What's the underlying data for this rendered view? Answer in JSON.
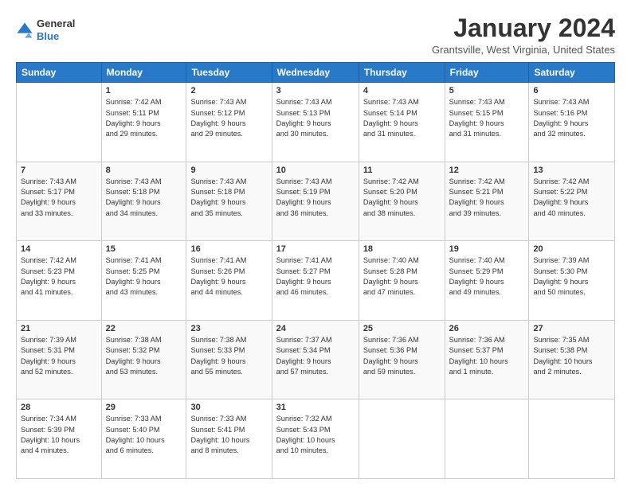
{
  "logo": {
    "general": "General",
    "blue": "Blue"
  },
  "title": "January 2024",
  "location": "Grantsville, West Virginia, United States",
  "days_of_week": [
    "Sunday",
    "Monday",
    "Tuesday",
    "Wednesday",
    "Thursday",
    "Friday",
    "Saturday"
  ],
  "weeks": [
    [
      {
        "day": "",
        "content": ""
      },
      {
        "day": "1",
        "content": "Sunrise: 7:42 AM\nSunset: 5:11 PM\nDaylight: 9 hours\nand 29 minutes."
      },
      {
        "day": "2",
        "content": "Sunrise: 7:43 AM\nSunset: 5:12 PM\nDaylight: 9 hours\nand 29 minutes."
      },
      {
        "day": "3",
        "content": "Sunrise: 7:43 AM\nSunset: 5:13 PM\nDaylight: 9 hours\nand 30 minutes."
      },
      {
        "day": "4",
        "content": "Sunrise: 7:43 AM\nSunset: 5:14 PM\nDaylight: 9 hours\nand 31 minutes."
      },
      {
        "day": "5",
        "content": "Sunrise: 7:43 AM\nSunset: 5:15 PM\nDaylight: 9 hours\nand 31 minutes."
      },
      {
        "day": "6",
        "content": "Sunrise: 7:43 AM\nSunset: 5:16 PM\nDaylight: 9 hours\nand 32 minutes."
      }
    ],
    [
      {
        "day": "7",
        "content": "Sunrise: 7:43 AM\nSunset: 5:17 PM\nDaylight: 9 hours\nand 33 minutes."
      },
      {
        "day": "8",
        "content": "Sunrise: 7:43 AM\nSunset: 5:18 PM\nDaylight: 9 hours\nand 34 minutes."
      },
      {
        "day": "9",
        "content": "Sunrise: 7:43 AM\nSunset: 5:18 PM\nDaylight: 9 hours\nand 35 minutes."
      },
      {
        "day": "10",
        "content": "Sunrise: 7:43 AM\nSunset: 5:19 PM\nDaylight: 9 hours\nand 36 minutes."
      },
      {
        "day": "11",
        "content": "Sunrise: 7:42 AM\nSunset: 5:20 PM\nDaylight: 9 hours\nand 38 minutes."
      },
      {
        "day": "12",
        "content": "Sunrise: 7:42 AM\nSunset: 5:21 PM\nDaylight: 9 hours\nand 39 minutes."
      },
      {
        "day": "13",
        "content": "Sunrise: 7:42 AM\nSunset: 5:22 PM\nDaylight: 9 hours\nand 40 minutes."
      }
    ],
    [
      {
        "day": "14",
        "content": "Sunrise: 7:42 AM\nSunset: 5:23 PM\nDaylight: 9 hours\nand 41 minutes."
      },
      {
        "day": "15",
        "content": "Sunrise: 7:41 AM\nSunset: 5:25 PM\nDaylight: 9 hours\nand 43 minutes."
      },
      {
        "day": "16",
        "content": "Sunrise: 7:41 AM\nSunset: 5:26 PM\nDaylight: 9 hours\nand 44 minutes."
      },
      {
        "day": "17",
        "content": "Sunrise: 7:41 AM\nSunset: 5:27 PM\nDaylight: 9 hours\nand 46 minutes."
      },
      {
        "day": "18",
        "content": "Sunrise: 7:40 AM\nSunset: 5:28 PM\nDaylight: 9 hours\nand 47 minutes."
      },
      {
        "day": "19",
        "content": "Sunrise: 7:40 AM\nSunset: 5:29 PM\nDaylight: 9 hours\nand 49 minutes."
      },
      {
        "day": "20",
        "content": "Sunrise: 7:39 AM\nSunset: 5:30 PM\nDaylight: 9 hours\nand 50 minutes."
      }
    ],
    [
      {
        "day": "21",
        "content": "Sunrise: 7:39 AM\nSunset: 5:31 PM\nDaylight: 9 hours\nand 52 minutes."
      },
      {
        "day": "22",
        "content": "Sunrise: 7:38 AM\nSunset: 5:32 PM\nDaylight: 9 hours\nand 53 minutes."
      },
      {
        "day": "23",
        "content": "Sunrise: 7:38 AM\nSunset: 5:33 PM\nDaylight: 9 hours\nand 55 minutes."
      },
      {
        "day": "24",
        "content": "Sunrise: 7:37 AM\nSunset: 5:34 PM\nDaylight: 9 hours\nand 57 minutes."
      },
      {
        "day": "25",
        "content": "Sunrise: 7:36 AM\nSunset: 5:36 PM\nDaylight: 9 hours\nand 59 minutes."
      },
      {
        "day": "26",
        "content": "Sunrise: 7:36 AM\nSunset: 5:37 PM\nDaylight: 10 hours\nand 1 minute."
      },
      {
        "day": "27",
        "content": "Sunrise: 7:35 AM\nSunset: 5:38 PM\nDaylight: 10 hours\nand 2 minutes."
      }
    ],
    [
      {
        "day": "28",
        "content": "Sunrise: 7:34 AM\nSunset: 5:39 PM\nDaylight: 10 hours\nand 4 minutes."
      },
      {
        "day": "29",
        "content": "Sunrise: 7:33 AM\nSunset: 5:40 PM\nDaylight: 10 hours\nand 6 minutes."
      },
      {
        "day": "30",
        "content": "Sunrise: 7:33 AM\nSunset: 5:41 PM\nDaylight: 10 hours\nand 8 minutes."
      },
      {
        "day": "31",
        "content": "Sunrise: 7:32 AM\nSunset: 5:43 PM\nDaylight: 10 hours\nand 10 minutes."
      },
      {
        "day": "",
        "content": ""
      },
      {
        "day": "",
        "content": ""
      },
      {
        "day": "",
        "content": ""
      }
    ]
  ]
}
